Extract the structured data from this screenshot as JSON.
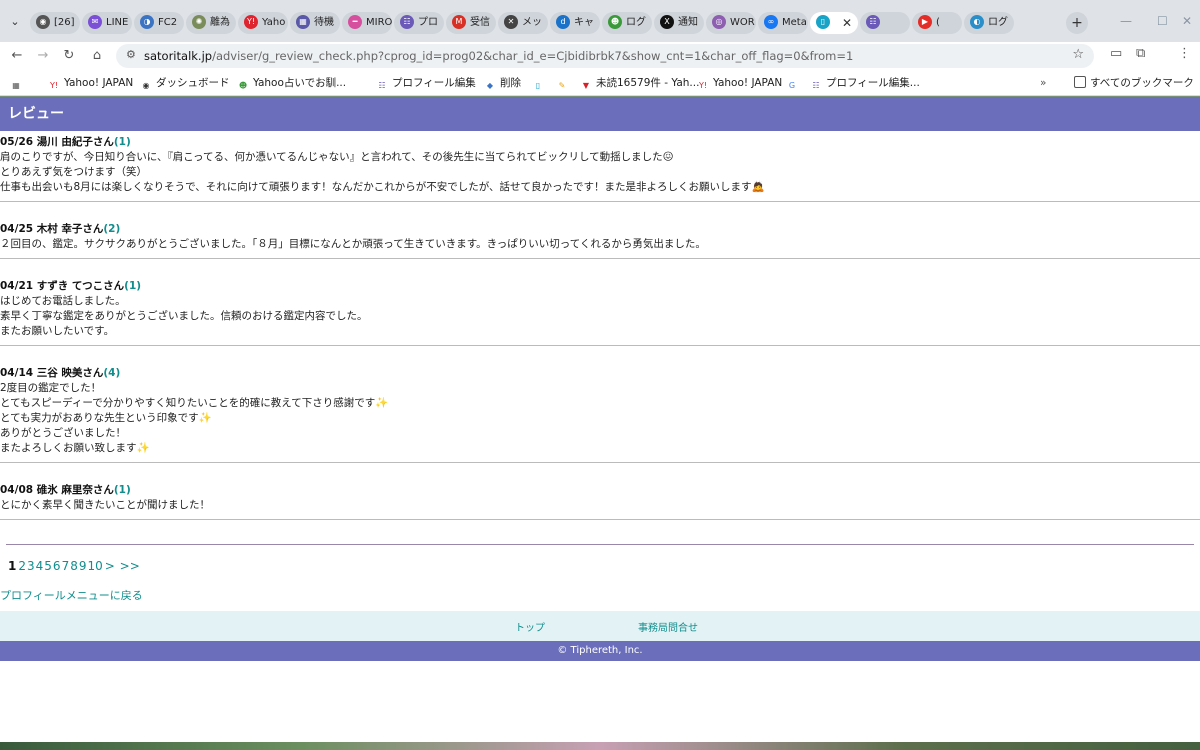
{
  "browser": {
    "tabs": [
      {
        "label": "[26]",
        "icon": "globe-icon",
        "color": "#555555",
        "glyph": "◉"
      },
      {
        "label": "LINE",
        "icon": "line-icon",
        "color": "#7b4fd6",
        "glyph": "✉"
      },
      {
        "label": "FC2",
        "icon": "fc2-icon",
        "color": "#3c74c4",
        "glyph": "◑"
      },
      {
        "label": "離為",
        "icon": "compass-icon",
        "color": "#7a8c5a",
        "glyph": "✺"
      },
      {
        "label": "Yaho",
        "icon": "yahoo-icon",
        "color": "#e0242f",
        "glyph": "Y!"
      },
      {
        "label": "待機",
        "icon": "calendar-icon",
        "color": "#5a58a8",
        "glyph": "▦"
      },
      {
        "label": "MIRO",
        "icon": "miro-icon",
        "color": "#d64f9f",
        "glyph": "━"
      },
      {
        "label": "プロ",
        "icon": "profile-icon",
        "color": "#6b5ab8",
        "glyph": "☷"
      },
      {
        "label": "受信",
        "icon": "gmail-icon",
        "color": "#d93025",
        "glyph": "M"
      },
      {
        "label": "メッ",
        "icon": "message-icon",
        "color": "#444444",
        "glyph": "✕"
      },
      {
        "label": "キャ",
        "icon": "d-icon",
        "color": "#1a73c9",
        "glyph": "d"
      },
      {
        "label": "ログ",
        "icon": "frog-icon",
        "color": "#3a9a3a",
        "glyph": "☻"
      },
      {
        "label": "通知",
        "icon": "x-icon",
        "color": "#111111",
        "glyph": "X"
      },
      {
        "label": "WOR",
        "icon": "wordpress-icon",
        "color": "#8e5fb0",
        "glyph": "◎"
      },
      {
        "label": "Meta",
        "icon": "meta-icon",
        "color": "#1877f2",
        "glyph": "∞"
      },
      {
        "label": "",
        "icon": "page-icon",
        "color": "#19a3c7",
        "glyph": "▯",
        "active": true
      },
      {
        "label": "",
        "icon": "record-icon",
        "color": "#6b5ab8",
        "glyph": "☷"
      },
      {
        "label": "(",
        "icon": "youtube-icon",
        "color": "#e52d27",
        "glyph": "▶"
      },
      {
        "label": "ログ",
        "icon": "login-icon",
        "color": "#2a8fc9",
        "glyph": "◐"
      }
    ],
    "url_domain": "satoritalk.jp",
    "url_path": "/adviser/g_review_check.php?cprog_id=prog02&char_id_e=Cjbidibrbk7&show_cnt=1&char_off_flag=0&from=1",
    "bookmarks": [
      {
        "label": "",
        "icon": "apps-grid-icon",
        "color": "#555555",
        "glyph": "▦"
      },
      {
        "label": "Yahoo! JAPAN",
        "icon": "yahoo-icon",
        "color": "#e0242f",
        "glyph": "Y!"
      },
      {
        "label": "ダッシュボード",
        "icon": "dashboard-icon",
        "color": "#333333",
        "glyph": "◉"
      },
      {
        "label": "Yahoo占いでお馴...",
        "icon": "frog-icon",
        "color": "#3a9a3a",
        "glyph": "☻"
      },
      {
        "label": "プロフィール編集",
        "icon": "profile-icon",
        "color": "#6b5ab8",
        "glyph": "☷"
      },
      {
        "label": "削除",
        "icon": "drive-icon",
        "color": "#3c74c4",
        "glyph": "◆"
      },
      {
        "label": "",
        "icon": "page-icon",
        "color": "#19a3c7",
        "glyph": "▯"
      },
      {
        "label": "",
        "icon": "pencil-icon",
        "color": "#e8a317",
        "glyph": "✎"
      },
      {
        "label": "未読16579件 - Yah...",
        "icon": "mail-flag-icon",
        "color": "#d6202a",
        "glyph": "▼"
      },
      {
        "label": "Yahoo! JAPAN",
        "icon": "yahoo-icon",
        "color": "#e0242f",
        "glyph": "Y!"
      },
      {
        "label": "",
        "icon": "google-icon",
        "color": "#4285f4",
        "glyph": "G"
      },
      {
        "label": "プロフィール編集...",
        "icon": "profile-icon",
        "color": "#6b5ab8",
        "glyph": "☷"
      }
    ],
    "all_bookmarks_label": "すべてのブックマーク"
  },
  "page": {
    "title": "レビュー",
    "reviews": [
      {
        "date_name": "05/26 湯川 由紀子さん",
        "count": "(1)",
        "lines": [
          "肩のこりですが、今日知り合いに、『肩こってる、何か憑いてるんじゃない』と言われて、その後先生に当てられてビックリして動揺しました😖",
          "とりあえず気をつけます（笑）",
          "仕事も出会いも8月には楽しくなりそうで、それに向けて頑張ります！なんだかこれからが不安でしたが、話せて良かったです！また是非よろしくお願いします🙇"
        ]
      },
      {
        "date_name": "04/25 木村 幸子さん",
        "count": "(2)",
        "lines": [
          "２回目の、鑑定。サクサクありがとうございました。「８月」目標になんとか頑張って生きていきます。きっぱりいい切ってくれるから勇気出ました。"
        ]
      },
      {
        "date_name": "04/21 すずき てつこさん",
        "count": "(1)",
        "lines": [
          "はじめてお電話しました。",
          "素早く丁寧な鑑定をありがとうございました。信頼のおける鑑定内容でした。",
          "またお願いしたいです。"
        ]
      },
      {
        "date_name": "04/14 三谷 映美さん",
        "count": "(4)",
        "lines": [
          "2度目の鑑定でした！",
          "とてもスピーディーで分かりやすく知りたいことを的確に教えて下さり感謝です✨",
          "とても実力がおありな先生という印象です✨",
          "ありがとうございました！",
          "またよろしくお願い致します✨"
        ]
      },
      {
        "date_name": "04/08 碓氷 麻里奈さん",
        "count": "(1)",
        "lines": [
          "とにかく素早く聞きたいことが聞けました！"
        ]
      }
    ],
    "pagination": {
      "current": "1",
      "pages": [
        "2",
        "3",
        "4",
        "5",
        "6",
        "7",
        "8",
        "9",
        "10"
      ],
      "next": ">",
      "last": ">>"
    },
    "back_link": "プロフィールメニューに戻る",
    "footer": {
      "links": [
        "トップ",
        "事務局問合せ"
      ],
      "copyright": "© Tiphereth, Inc."
    }
  }
}
